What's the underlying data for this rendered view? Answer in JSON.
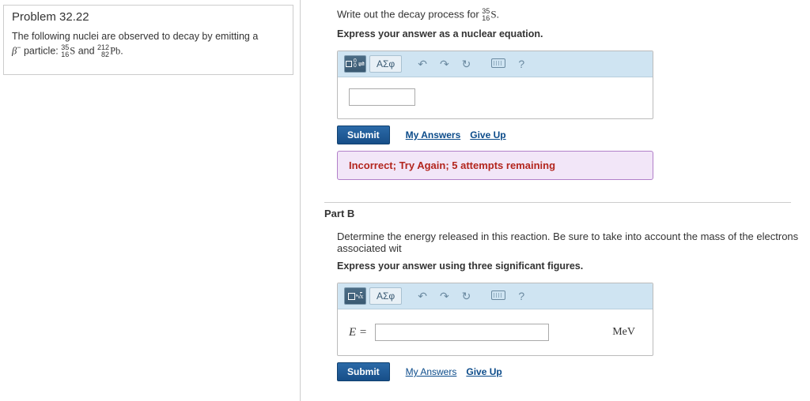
{
  "problem": {
    "title": "Problem 32.22",
    "desc_lead": "The following nuclei are observed to decay by emitting a ",
    "beta": "β",
    "sup_minus": "−",
    "particle_word": " particle: ",
    "n1_top": "35",
    "n1_bot": "16",
    "n1_sym": "S",
    "and_word": " and ",
    "n2_top": "212",
    "n2_bot": "82",
    "n2_sym": "Pb",
    "period": "."
  },
  "partA": {
    "prompt_lead": "Write out the decay process for ",
    "na_top": "35",
    "na_bot": "16",
    "na_sym": "S",
    "prompt_tail": ".",
    "subprompt": "Express your answer as a nuclear equation.",
    "toolbar": {
      "template_tip": "x⁰⁄y⇌",
      "greek": "ΑΣφ",
      "help": "?"
    },
    "submit": "Submit",
    "my_answers": "My Answers",
    "give_up": "Give Up",
    "feedback": "Incorrect; Try Again; 5 attempts remaining"
  },
  "partB": {
    "title": "Part B",
    "prompt": "Determine the energy released in this reaction. Be sure to take into account the mass of the electrons associated wit",
    "subprompt": "Express your answer using three significant figures.",
    "toolbar": {
      "template_tip": "√x̄",
      "greek": "ΑΣφ",
      "help": "?"
    },
    "evar": "E =",
    "unit": "MeV",
    "submit": "Submit",
    "my_answers": "My Answers",
    "give_up": "Give Up"
  }
}
